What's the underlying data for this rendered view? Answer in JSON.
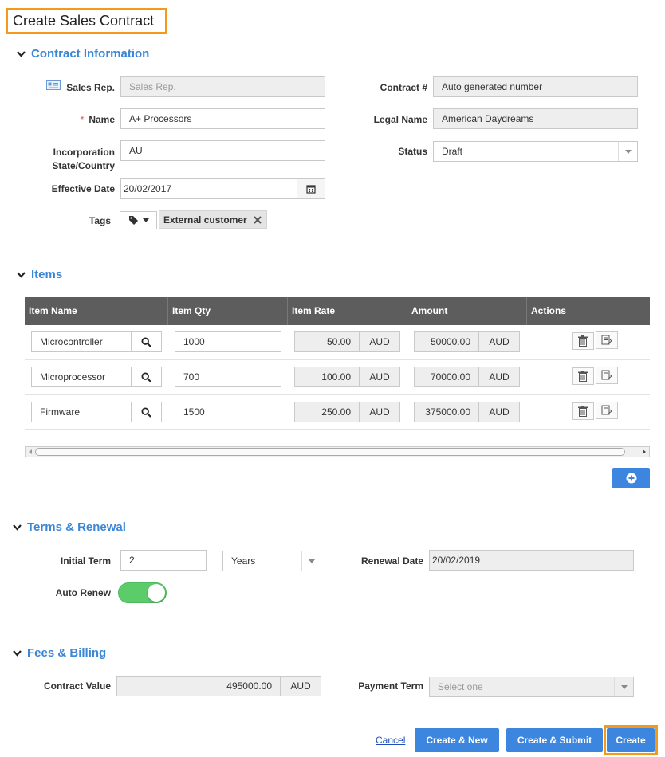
{
  "page": {
    "title": "Create Sales Contract"
  },
  "colors": {
    "accent": "#3c86e0",
    "highlight": "#f39a1b",
    "toggle_on": "#5ccc6b",
    "header_bg": "#5d5d5d"
  },
  "contract_info": {
    "heading": "Contract Information",
    "sales_rep": {
      "label": "Sales Rep.",
      "placeholder": "Sales Rep."
    },
    "contract_no": {
      "label": "Contract #",
      "value": "Auto generated number"
    },
    "name": {
      "required_mark": "*",
      "label": "Name",
      "value": "A+ Processors"
    },
    "legal_name": {
      "label": "Legal Name",
      "value": "American Daydreams"
    },
    "incorporation": {
      "label_line1": "Incorporation",
      "label_line2": "State/Country",
      "value": "AU"
    },
    "status": {
      "label": "Status",
      "value": "Draft"
    },
    "effective_date": {
      "label": "Effective Date",
      "value": "20/02/2017"
    },
    "tags": {
      "label": "Tags",
      "items": [
        "External customer"
      ]
    }
  },
  "items": {
    "heading": "Items",
    "columns": [
      "Item Name",
      "Item Qty",
      "Item Rate",
      "Amount",
      "Actions"
    ],
    "rows": [
      {
        "name": "Microcontroller",
        "qty": "1000",
        "rate": "50.00",
        "rate_cur": "AUD",
        "amount": "50000.00",
        "amount_cur": "AUD"
      },
      {
        "name": "Microprocessor",
        "qty": "700",
        "rate": "100.00",
        "rate_cur": "AUD",
        "amount": "70000.00",
        "amount_cur": "AUD"
      },
      {
        "name": "Firmware",
        "qty": "1500",
        "rate": "250.00",
        "rate_cur": "AUD",
        "amount": "375000.00",
        "amount_cur": "AUD"
      }
    ]
  },
  "terms": {
    "heading": "Terms & Renewal",
    "initial_term": {
      "label": "Initial Term",
      "value": "2",
      "unit": "Years"
    },
    "renewal_date": {
      "label": "Renewal Date",
      "value": "20/02/2019"
    },
    "auto_renew": {
      "label": "Auto Renew",
      "on": true
    }
  },
  "fees": {
    "heading": "Fees & Billing",
    "contract_value": {
      "label": "Contract Value",
      "value": "495000.00",
      "currency": "AUD"
    },
    "payment_term": {
      "label": "Payment Term",
      "placeholder": "Select one"
    }
  },
  "footer": {
    "cancel": "Cancel",
    "create_new": "Create & New",
    "create_submit": "Create & Submit",
    "create": "Create"
  }
}
